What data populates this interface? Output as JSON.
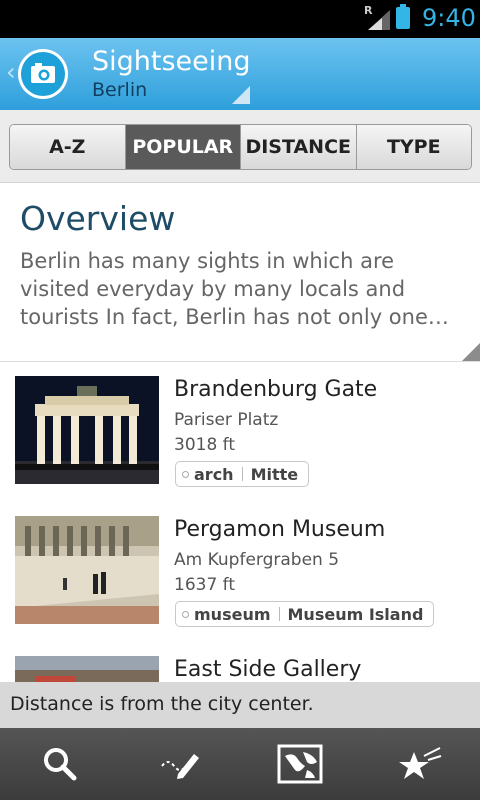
{
  "status": {
    "time": "9:40",
    "network": "R"
  },
  "header": {
    "title": "Sightseeing",
    "subtitle": "Berlin"
  },
  "tabs": [
    {
      "label": "A-Z",
      "active": false
    },
    {
      "label": "POPULAR",
      "active": true
    },
    {
      "label": "DISTANCE",
      "active": false
    },
    {
      "label": "TYPE",
      "active": false
    }
  ],
  "overview": {
    "heading": "Overview",
    "text": "Berlin has many sights in which are visited everyday by many locals and tourists  In fact, Berlin has not only one…"
  },
  "items": [
    {
      "name": "Brandenburg Gate",
      "address": "Pariser Platz",
      "distance": "3018 ft",
      "tags": [
        "arch",
        "Mitte"
      ]
    },
    {
      "name": "Pergamon Museum",
      "address": "Am Kupfergraben 5",
      "distance": "1637 ft",
      "tags": [
        "museum",
        "Museum Island"
      ]
    },
    {
      "name": "East Side Gallery"
    }
  ],
  "toast": {
    "message": "Distance is from the city center."
  },
  "bottom_nav": [
    {
      "icon": "search-icon"
    },
    {
      "icon": "pencil-icon"
    },
    {
      "icon": "map-icon"
    },
    {
      "icon": "favorites-icon"
    }
  ]
}
